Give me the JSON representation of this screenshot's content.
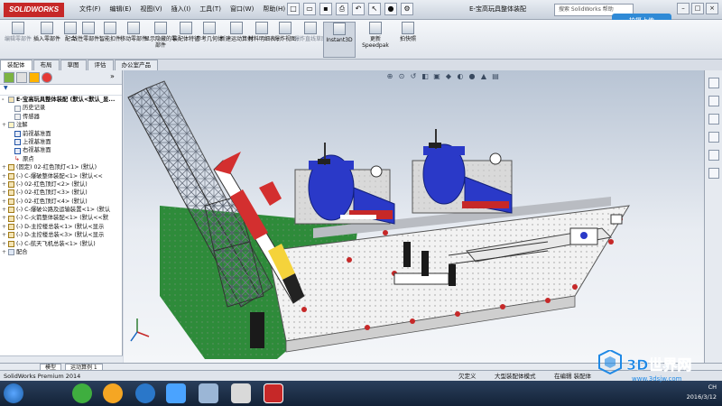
{
  "app": {
    "logo": "SOLIDWORKS",
    "window_title": "E-宝高玩具整体装配",
    "search_placeholder": "搜索 SolidWorks 帮助",
    "upload_button": "拍摄上传"
  },
  "menu": [
    "文件(F)",
    "编辑(E)",
    "视图(V)",
    "插入(I)",
    "工具(T)",
    "窗口(W)",
    "帮助(H)"
  ],
  "commands": [
    {
      "label": "编辑零部件",
      "disabled": true
    },
    {
      "label": "插入零部件",
      "disabled": false
    },
    {
      "label": "配合",
      "disabled": false
    },
    {
      "label": "线性零部件...",
      "disabled": false
    },
    {
      "label": "智能扣件",
      "disabled": false
    },
    {
      "label": "移动零部件",
      "disabled": false
    },
    {
      "label": "显示隐藏的零部件",
      "disabled": false
    },
    {
      "label": "装配体特征",
      "disabled": false
    },
    {
      "label": "参考几何体",
      "disabled": false
    },
    {
      "label": "新建运动算例",
      "disabled": false
    },
    {
      "label": "材料明细表",
      "disabled": false
    },
    {
      "label": "爆炸视图",
      "disabled": false
    },
    {
      "label": "爆炸直线草图",
      "disabled": true
    },
    {
      "label": "Instant3D",
      "disabled": false,
      "active": true
    },
    {
      "label": "更新Speedpak",
      "disabled": false
    },
    {
      "label": "拍快照",
      "disabled": false
    }
  ],
  "tabs": [
    "装配体",
    "布局",
    "草图",
    "评估",
    "办公室产品"
  ],
  "tree": {
    "root": "E-宝高玩具整体装配 (默认<默认_显...",
    "items": [
      {
        "label": "历史记录",
        "kind": "folder",
        "indent": true
      },
      {
        "label": "传感器",
        "kind": "folder",
        "indent": true
      },
      {
        "label": "注解",
        "kind": "annot",
        "indent": false
      },
      {
        "label": "前视基准面",
        "kind": "plane",
        "indent": true
      },
      {
        "label": "上视基准面",
        "kind": "plane",
        "indent": true
      },
      {
        "label": "右视基准面",
        "kind": "plane",
        "indent": true
      },
      {
        "label": "原点",
        "kind": "origin",
        "indent": true
      },
      {
        "label": "(固定) 02-红色顶灯<1> (默认)",
        "kind": "comp"
      },
      {
        "label": "(-) C-爆破整体装配<1> (默认<<",
        "kind": "comp"
      },
      {
        "label": "(-) 02-红色顶灯<2> (默认)",
        "kind": "comp"
      },
      {
        "label": "(-) 02-红色顶灯<3> (默认)",
        "kind": "comp"
      },
      {
        "label": "(-) 02-红色顶灯<4> (默认)",
        "kind": "comp"
      },
      {
        "label": "(-) C-爆破公路及运输装置<1> (默认",
        "kind": "comp"
      },
      {
        "label": "(-) C-火箭整体装配<1> (默认<<默",
        "kind": "comp"
      },
      {
        "label": "(-) D-主控楼总装<1> (默认<显示",
        "kind": "comp"
      },
      {
        "label": "(-) D-主控楼总装<3> (默认<显示",
        "kind": "comp"
      },
      {
        "label": "(-) C-航天飞机总装<1> (默认)",
        "kind": "comp"
      },
      {
        "label": "配合",
        "kind": "mates",
        "indent": false
      }
    ]
  },
  "bottom_tabs": [
    "模型",
    "运动算例 1"
  ],
  "status": {
    "left": "SolidWorks Premium 2014",
    "mid1": "欠定义",
    "mid2": "大型装配体模式",
    "mid3": "在编辑 装配体"
  },
  "taskbar": {
    "time": "",
    "date": "2016/3/12",
    "lang": "CH"
  },
  "watermark": {
    "text": "3D世界网",
    "sub": "www.3dsjw.com"
  },
  "colors": {
    "accent_red": "#c62828",
    "vp_top": "#b8c4d4",
    "base_white": "#f2f2f2",
    "tank_blue": "#2a39c8",
    "grass_green": "#2e8b3a"
  }
}
